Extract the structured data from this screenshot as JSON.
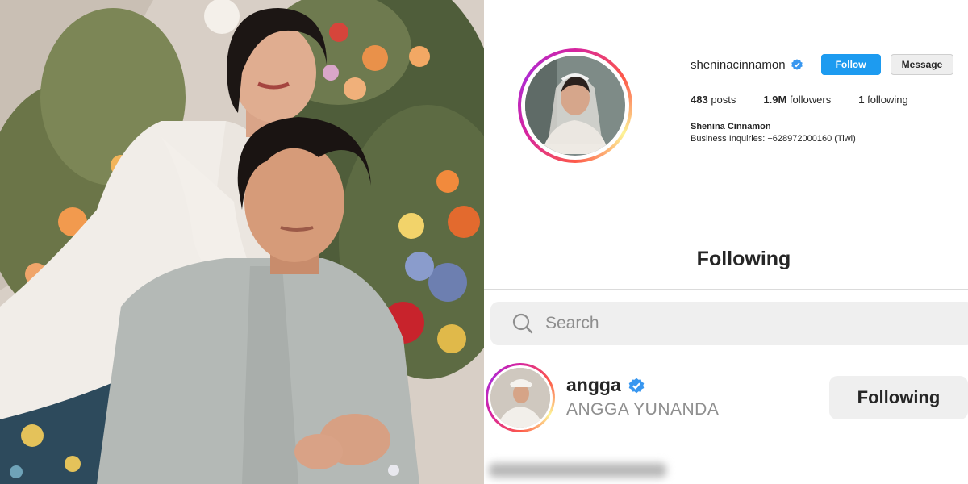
{
  "profile": {
    "username": "sheninacinnamon",
    "follow_label": "Follow",
    "message_label": "Message",
    "stats": {
      "posts_count": "483",
      "posts_label": "posts",
      "followers_count": "1.9M",
      "followers_label": "followers",
      "following_count": "1",
      "following_label": "following"
    },
    "full_name": "Shenina Cinnamon",
    "bio": "Business Inquiries: +628972000160 (Tiwi)"
  },
  "modal": {
    "title": "Following"
  },
  "search": {
    "placeholder": "Search"
  },
  "following_list": [
    {
      "username": "angga",
      "full_name": "ANGGA YUNANDA",
      "button_label": "Following",
      "verified": true
    }
  ],
  "colors": {
    "follow_button": "#1d9bf0",
    "verified_badge": "#3897f0",
    "secondary_text": "#8e8e8e",
    "primary_text": "#262626"
  },
  "icons": {
    "verified": "verified-badge-icon",
    "search": "search-icon"
  }
}
